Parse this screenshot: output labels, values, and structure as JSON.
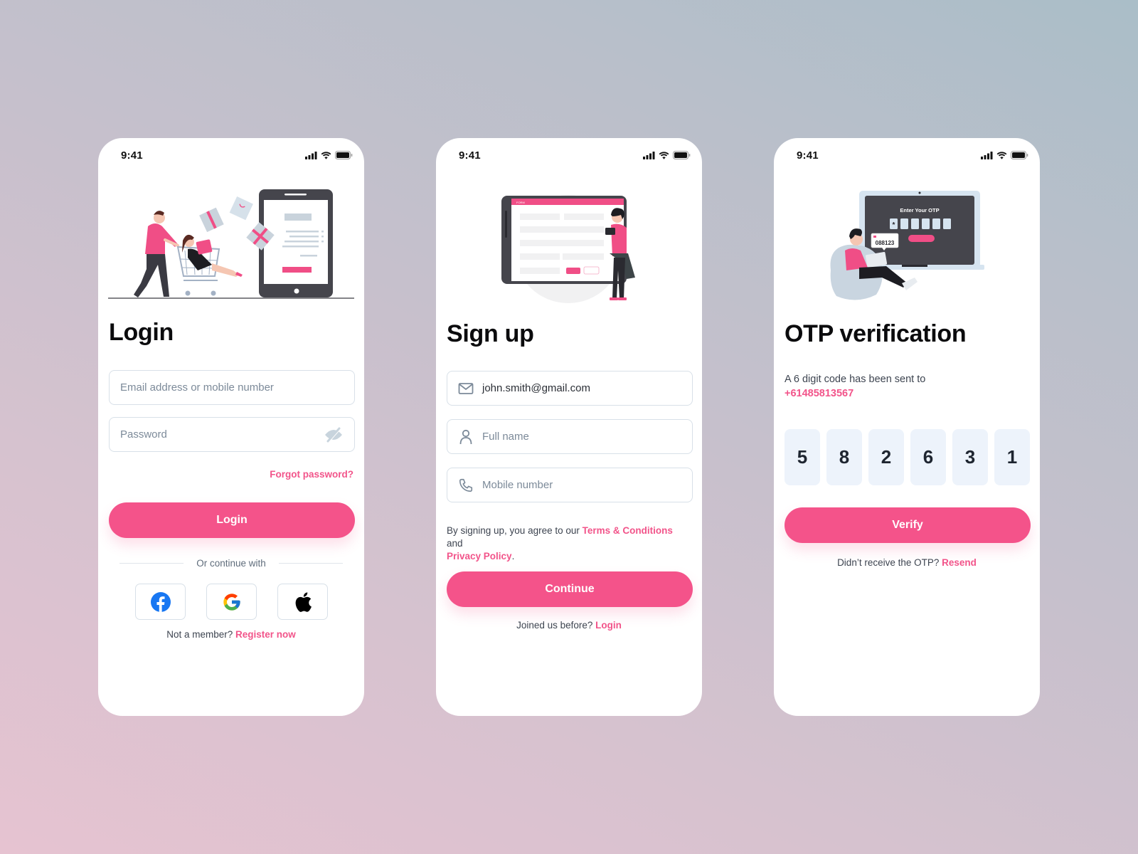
{
  "theme": {
    "accent": "#f4538a",
    "text_dark": "#0b0b0d",
    "placeholder": "#7c8a99",
    "border": "#d8e0e8",
    "otp_box_bg": "#edf3fb"
  },
  "status_bar": {
    "time": "9:41",
    "icons": [
      "cellular-signal-icon",
      "wifi-icon",
      "battery-icon"
    ]
  },
  "login": {
    "illustration": "online-shopping-illustration",
    "title": "Login",
    "email_placeholder": "Email address or mobile number",
    "password_placeholder": "Password",
    "password_toggle_icon": "eye-off-icon",
    "forgot_password": "Forgot password?",
    "login_button": "Login",
    "divider_label": "Or continue with",
    "social": [
      {
        "name": "facebook",
        "icon": "facebook-icon"
      },
      {
        "name": "google",
        "icon": "google-icon"
      },
      {
        "name": "apple",
        "icon": "apple-icon"
      }
    ],
    "footer_prompt": "Not a member?",
    "footer_link": "Register now"
  },
  "signup": {
    "illustration": "form-tablet-illustration",
    "illustration_form_header": "FORM",
    "title": "Sign up",
    "email_value": "john.smith@gmail.com",
    "email_icon": "mail-icon",
    "fullname_placeholder": "Full name",
    "fullname_icon": "user-icon",
    "mobile_placeholder": "Mobile number",
    "mobile_icon": "phone-icon",
    "terms_prefix": "By signing up, you agree to our",
    "terms_link": "Terms & Conditions",
    "terms_and": "and",
    "privacy_link": "Privacy Policy",
    "terms_suffix": ".",
    "continue_button": "Continue",
    "footer_prompt": "Joined us before?",
    "footer_link": "Login"
  },
  "otp": {
    "illustration": "otp-laptop-illustration",
    "illustration_heading": "Enter Your OTP",
    "illustration_code": "088123",
    "title": "OTP verification",
    "message": "A 6 digit code has been sent to",
    "phone_number": "+61485813567",
    "digits": [
      "5",
      "8",
      "2",
      "6",
      "3",
      "1"
    ],
    "verify_button": "Verify",
    "footer_prompt": "Didn’t receive the OTP?",
    "footer_link": "Resend"
  }
}
